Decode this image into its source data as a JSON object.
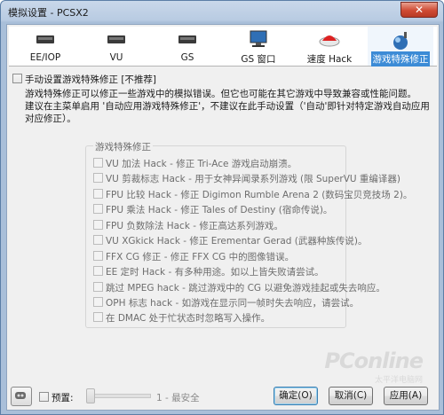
{
  "window": {
    "title": "模拟设置 - PCSX2"
  },
  "tabs": [
    {
      "label": "EE/IOP",
      "icon": "chip-icon"
    },
    {
      "label": "VU",
      "icon": "chip-icon"
    },
    {
      "label": "GS",
      "icon": "chip-icon"
    },
    {
      "label": "GS 窗口",
      "icon": "monitor-icon"
    },
    {
      "label": "速度 Hack",
      "icon": "speed-hack-icon"
    },
    {
      "label": "游戏特殊修正",
      "icon": "gamefix-icon",
      "active": true
    }
  ],
  "main": {
    "enable_label": "手动设置游戏特殊修正 [不推荐]",
    "desc_line1": "游戏特殊修正可以修正一些游戏中的模拟错误。但它也可能在其它游戏中导致兼容或性能问题。",
    "desc_line2": "建议在主菜单启用 '自动应用游戏特殊修正'，不建议在此手动设置（'自动'即针对特定游戏自动应用对应修正）。"
  },
  "group": {
    "title": "游戏特殊修正",
    "items": [
      "VU 加法 Hack - 修正 Tri-Ace 游戏启动崩溃。",
      "VU 剪裁标志 Hack - 用于女神异闻录系列游戏 (限 SuperVU 重编译器)",
      "FPU 比较 Hack - 修正 Digimon Rumble Arena 2 (数码宝贝竞技场 2)。",
      "FPU 乘法 Hack - 修正 Tales of Destiny (宿命传说)。",
      "FPU 负数除法 Hack - 修正高达系列游戏。",
      "VU XGkick Hack - 修正 Erementar Gerad (武器种族传说)。",
      "FFX CG 修正 - 修正 FFX CG 中的图像错误。",
      "EE 定时 Hack - 有多种用途。如以上皆失败请尝试。",
      "跳过 MPEG hack - 跳过游戏中的 CG 以避免游戏挂起或失去响应。",
      "OPH 标志 hack - 如游戏在显示同一帧时失去响应，请尝试。",
      "在 DMAC 处于忙状态时忽略写入操作。"
    ]
  },
  "footer": {
    "preset_label": "预置:",
    "preset_value": "1 - 最安全",
    "ok": "确定(O)",
    "cancel": "取消(C)",
    "apply": "应用(A)"
  },
  "watermark": {
    "brand": "PConline",
    "sub": "太平洋电脑网"
  },
  "colors": {
    "active_tab": "#3c8bd6",
    "title_bar": "#b8cbe2"
  }
}
